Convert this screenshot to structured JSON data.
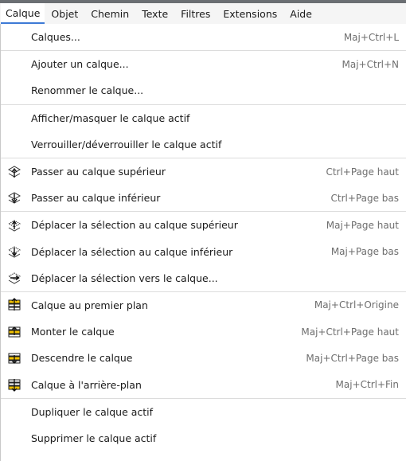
{
  "menubar": {
    "items": [
      {
        "label": "Calque",
        "active": true
      },
      {
        "label": "Objet"
      },
      {
        "label": "Chemin"
      },
      {
        "label": "Texte"
      },
      {
        "label": "Filtres"
      },
      {
        "label": "Extensions"
      },
      {
        "label": "Aide"
      }
    ]
  },
  "menu": {
    "items": [
      {
        "label": "Calques...",
        "shortcut": "Maj+Ctrl+L"
      },
      {
        "label": "Ajouter un calque...",
        "shortcut": "Maj+Ctrl+N"
      },
      {
        "label": "Renommer le calque...",
        "shortcut": ""
      },
      {
        "label": "Afficher/masquer le calque actif",
        "shortcut": ""
      },
      {
        "label": "Verrouiller/déverrouiller le calque actif",
        "shortcut": ""
      },
      {
        "label": "Passer au calque supérieur",
        "shortcut": "Ctrl+Page haut",
        "icon": "switch-layer-up-icon"
      },
      {
        "label": "Passer au calque inférieur",
        "shortcut": "Ctrl+Page bas",
        "icon": "switch-layer-down-icon"
      },
      {
        "label": "Déplacer la sélection au calque supérieur",
        "shortcut": "Maj+Page haut",
        "icon": "move-selection-layer-up-icon"
      },
      {
        "label": "Déplacer la sélection au calque inférieur",
        "shortcut": "Maj+Page bas",
        "icon": "move-selection-layer-down-icon"
      },
      {
        "label": "Déplacer la sélection vers le calque...",
        "shortcut": "",
        "icon": "move-selection-to-layer-icon"
      },
      {
        "label": "Calque au premier plan",
        "shortcut": "Maj+Ctrl+Origine",
        "icon": "layer-to-top-icon"
      },
      {
        "label": "Monter le calque",
        "shortcut": "Maj+Ctrl+Page haut",
        "icon": "raise-layer-icon"
      },
      {
        "label": "Descendre le calque",
        "shortcut": "Maj+Ctrl+Page bas",
        "icon": "lower-layer-icon"
      },
      {
        "label": "Calque à l'arrière-plan",
        "shortcut": "Maj+Ctrl+Fin",
        "icon": "layer-to-bottom-icon"
      },
      {
        "label": "Dupliquer le calque actif",
        "shortcut": ""
      },
      {
        "label": "Supprimer le calque actif",
        "shortcut": ""
      }
    ]
  },
  "colors": {
    "accent_underline": "#3d7ad6",
    "menubar_bg": "#f5f5f5",
    "shortcut_text": "#6e6e6e",
    "separator": "#dcdcdc",
    "icon_yellow": "#f2c200"
  }
}
